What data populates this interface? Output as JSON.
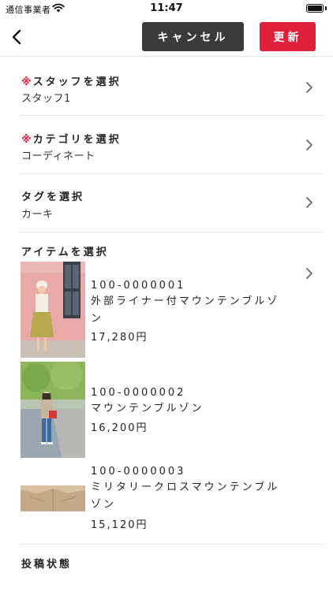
{
  "status_bar": {
    "carrier": "通信事業者",
    "time": "11:47"
  },
  "nav": {
    "cancel_label": "キャンセル",
    "update_label": "更新",
    "accent_color": "#e0213c"
  },
  "rows": {
    "staff": {
      "required_mark": "※",
      "title": "スタッフを選択",
      "value": "スタッフ1"
    },
    "category": {
      "required_mark": "※",
      "title": "カテゴリを選択",
      "value": "コーディネート"
    },
    "tag": {
      "title": "タグを選択",
      "value": "カーキ"
    },
    "items": {
      "title": "アイテムを選択"
    }
  },
  "items": [
    {
      "code": "100-0000001",
      "name": "外部ライナー付マウンテンブルゾン",
      "price": "17,280円"
    },
    {
      "code": "100-0000002",
      "name": "マウンテンブルゾン",
      "price": "16,200円"
    },
    {
      "code": "100-0000003",
      "name": "ミリタリークロスマウンテンブルゾン",
      "price": "15,120円"
    }
  ],
  "post_status": {
    "title": "投稿状態"
  }
}
